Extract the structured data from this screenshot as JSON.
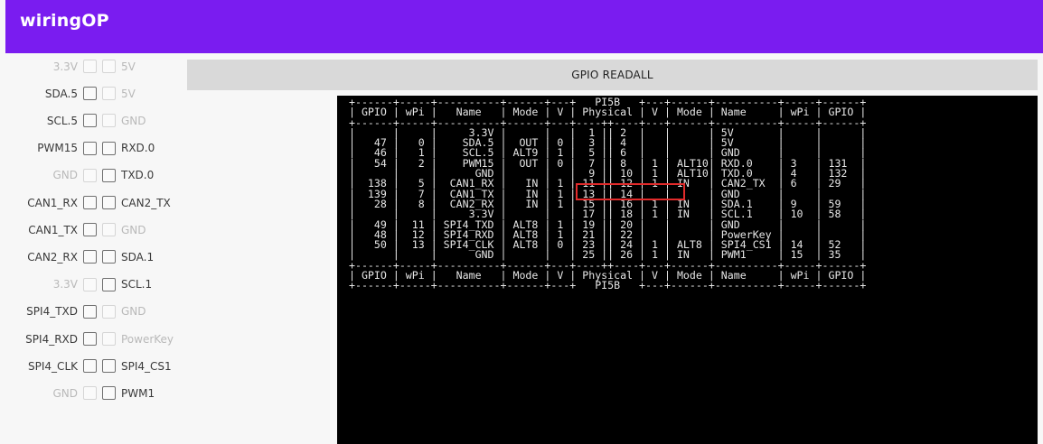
{
  "app": {
    "title": "wiringOP"
  },
  "button": {
    "readall_label": "GPIO READALL"
  },
  "pins": [
    {
      "left": {
        "label": "3.3V",
        "enabled": false
      },
      "right": {
        "label": "5V",
        "enabled": false
      }
    },
    {
      "left": {
        "label": "SDA.5",
        "enabled": true
      },
      "right": {
        "label": "5V",
        "enabled": false
      }
    },
    {
      "left": {
        "label": "SCL.5",
        "enabled": true
      },
      "right": {
        "label": "GND",
        "enabled": false
      }
    },
    {
      "left": {
        "label": "PWM15",
        "enabled": true
      },
      "right": {
        "label": "RXD.0",
        "enabled": true
      }
    },
    {
      "left": {
        "label": "GND",
        "enabled": false
      },
      "right": {
        "label": "TXD.0",
        "enabled": true
      }
    },
    {
      "left": {
        "label": "CAN1_RX",
        "enabled": true
      },
      "right": {
        "label": "CAN2_TX",
        "enabled": true
      }
    },
    {
      "left": {
        "label": "CAN1_TX",
        "enabled": true
      },
      "right": {
        "label": "GND",
        "enabled": false
      }
    },
    {
      "left": {
        "label": "CAN2_RX",
        "enabled": true
      },
      "right": {
        "label": "SDA.1",
        "enabled": true
      }
    },
    {
      "left": {
        "label": "3.3V",
        "enabled": false
      },
      "right": {
        "label": "SCL.1",
        "enabled": true
      }
    },
    {
      "left": {
        "label": "SPI4_TXD",
        "enabled": true
      },
      "right": {
        "label": "GND",
        "enabled": false
      }
    },
    {
      "left": {
        "label": "SPI4_RXD",
        "enabled": true
      },
      "right": {
        "label": "PowerKey",
        "enabled": false
      }
    },
    {
      "left": {
        "label": "SPI4_CLK",
        "enabled": true
      },
      "right": {
        "label": "SPI4_CS1",
        "enabled": true
      }
    },
    {
      "left": {
        "label": "GND",
        "enabled": false
      },
      "right": {
        "label": "PWM1",
        "enabled": true
      }
    }
  ],
  "terminal": {
    "lines": [
      " +------+-----+----------+------+---+   PI5B   +---+------+----------+-----+------+",
      " | GPIO | wPi |   Name   | Mode | V | Physical | V | Mode | Name     | wPi | GPIO |",
      " +------+-----+----------+------+---+----++----+---+------+----------+-----+------+",
      " |      |     |     3.3V |      |   |  1 || 2  |   |      | 5V       |     |      |",
      " |   47 |   0 |    SDA.5 |  OUT | 0 |  3 || 4  |   |      | 5V       |     |      |",
      " |   46 |   1 |    SCL.5 | ALT9 | 1 |  5 || 6  |   |      | GND      |     |      |",
      " |   54 |   2 |    PWM15 |  OUT | 0 |  7 || 8  | 1 | ALT10| RXD.0    | 3   | 131  |",
      " |      |     |      GND |      |   |  9 || 10 | 1 | ALT10| TXD.0    | 4   | 132  |",
      " |  138 |   5 |  CAN1_RX |   IN | 1 | 11 || 12 | 1 | IN   | CAN2_TX  | 6   | 29   |",
      " |  139 |   7 |  CAN1_TX |   IN | 1 | 13 || 14 |   |      | GND      |     |      |",
      " |   28 |   8 |  CAN2_RX |   IN | 1 | 15 || 16 | 1 | IN   | SDA.1    | 9   | 59   |",
      " |      |     |     3.3V |      |   | 17 || 18 | 1 | IN   | SCL.1    | 10  | 58   |",
      " |   49 |  11 | SPI4_TXD | ALT8 | 1 | 19 || 20 |   |      | GND      |     |      |",
      " |   48 |  12 | SPI4_RXD | ALT8 | 1 | 21 || 22 |   |      | PowerKey |     |      |",
      " |   50 |  13 | SPI4_CLK | ALT8 | 0 | 23 || 24 | 1 | ALT8 | SPI4_CS1 | 14  | 52   |",
      " |      |     |      GND |      |   | 25 || 26 | 1 | IN   | PWM1     | 15  | 35   |",
      " +------+-----+----------+------+---+----++----+---+------+----------+-----+------+",
      " | GPIO | wPi |   Name   | Mode | V | Physical | V | Mode | Name     | wPi | GPIO |",
      " +------+-----+----------+------+---+   PI5B   +---+------+----------+-----+------+"
    ],
    "highlight_color": "#e22b2b"
  },
  "colors": {
    "appbar": "#7a1cf0",
    "terminal_bg": "#000000",
    "terminal_fg": "#e6e6e6"
  }
}
